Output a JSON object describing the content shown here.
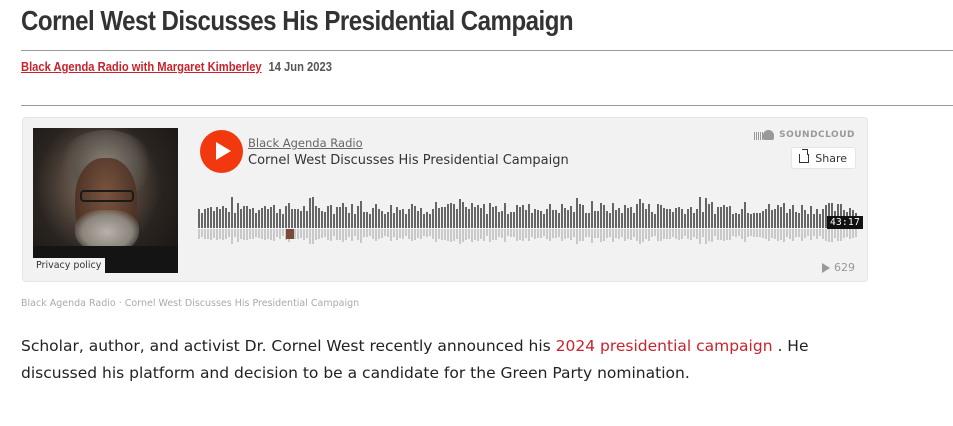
{
  "article": {
    "title": "Cornel West Discusses His Presidential Campaign",
    "author_link": "Black Agenda Radio with Margaret Kimberley",
    "date": "14 Jun 2023"
  },
  "player": {
    "privacy_label": "Privacy policy",
    "user": "Black Agenda Radio",
    "track_title": "Cornel West Discusses His Presidential Campaign",
    "brand": "SOUNDCLOUD",
    "share_label": "Share",
    "duration": "43:17",
    "play_count": "629",
    "accent_color": "#f2380f",
    "progress": 0
  },
  "caption": {
    "user": "Black Agenda Radio",
    "separator": "·",
    "track": "Cornel West Discusses His Presidential Campaign"
  },
  "body": {
    "text_before": "Scholar, author, and activist Dr. Cornel West recently announced his ",
    "link_text": "2024 presidential campaign",
    "text_after": " . He discussed his platform and decision to be a candidate for the Green Party nomination.",
    "link_color": "#c8232c"
  }
}
